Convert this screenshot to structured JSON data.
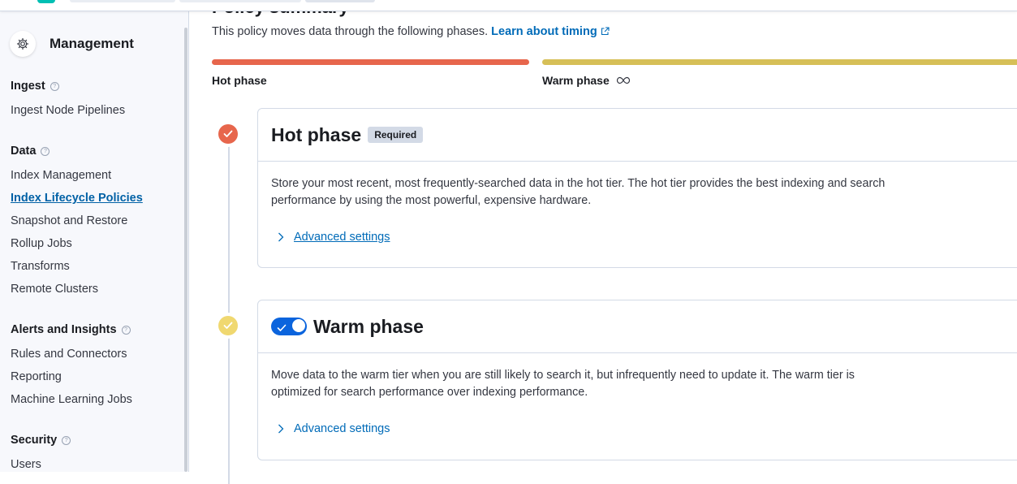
{
  "sidebar": {
    "title": "Management",
    "groups": [
      {
        "label": "Ingest",
        "items": [
          "Ingest Node Pipelines"
        ]
      },
      {
        "label": "Data",
        "items": [
          "Index Management",
          "Index Lifecycle Policies",
          "Snapshot and Restore",
          "Rollup Jobs",
          "Transforms",
          "Remote Clusters"
        ]
      },
      {
        "label": "Alerts and Insights",
        "items": [
          "Rules and Connectors",
          "Reporting",
          "Machine Learning Jobs"
        ]
      },
      {
        "label": "Security",
        "items": [
          "Users"
        ]
      }
    ],
    "active_item": "Index Lifecycle Policies"
  },
  "summary": {
    "title": "Policy summary",
    "description": "This policy moves data through the following phases.",
    "link": "Learn about timing"
  },
  "phase_bar": {
    "hot_label": "Hot phase",
    "warm_label": "Warm phase",
    "hot_color": "#e7664c",
    "warm_color": "#d6bf57"
  },
  "hot_phase": {
    "title": "Hot phase",
    "badge": "Required",
    "description": "Store your most recent, most frequently-searched data in the hot tier. The hot tier provides the best indexing and search performance by using the most powerful, expensive hardware.",
    "advanced": "Advanced settings"
  },
  "warm_phase": {
    "title": "Warm phase",
    "enabled": true,
    "description": "Move data to the warm tier when you are still likely to search it, but infrequently need to update it. The warm tier is optimized for search performance over indexing performance.",
    "advanced": "Advanced settings"
  }
}
